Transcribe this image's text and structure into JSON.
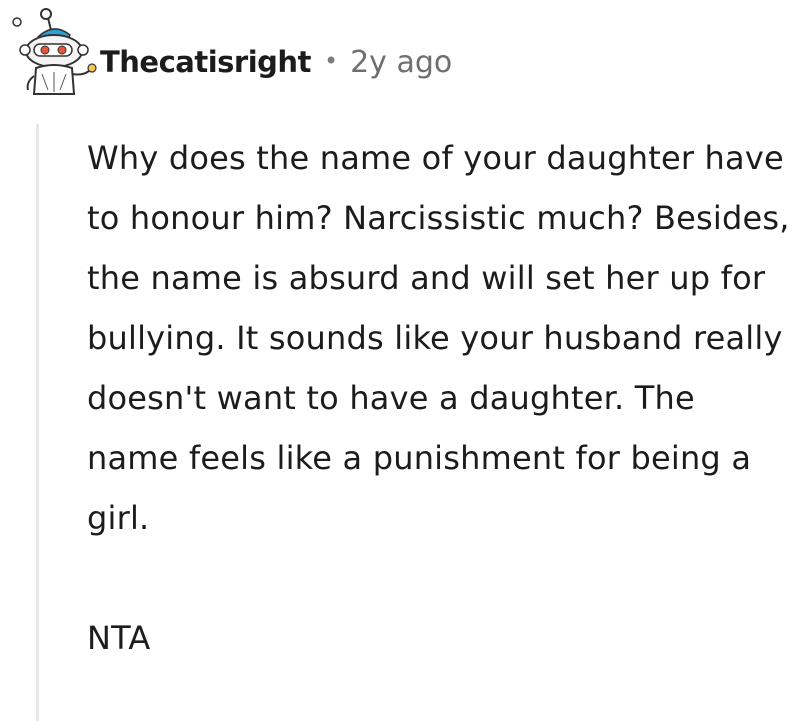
{
  "comment": {
    "username": "Thecatisright",
    "separator": "•",
    "timestamp": "2y ago",
    "avatar_icon": "reddit-snoo-avatar-icon",
    "body": {
      "paragraph_1": "Why does the name of your daughter have to honour him? Narcissistic much? Besides, the name is absurd and will set her up for bullying. It sounds like your husband really doesn't want to have a daughter. The name feels like a punishment for being a girl.",
      "paragraph_2": "NTA"
    }
  },
  "colors": {
    "text": "#1c1c1c",
    "meta": "#6f6f6f",
    "thread_line": "#e8e8e8",
    "avatar_accent": "#2e9fd8"
  }
}
